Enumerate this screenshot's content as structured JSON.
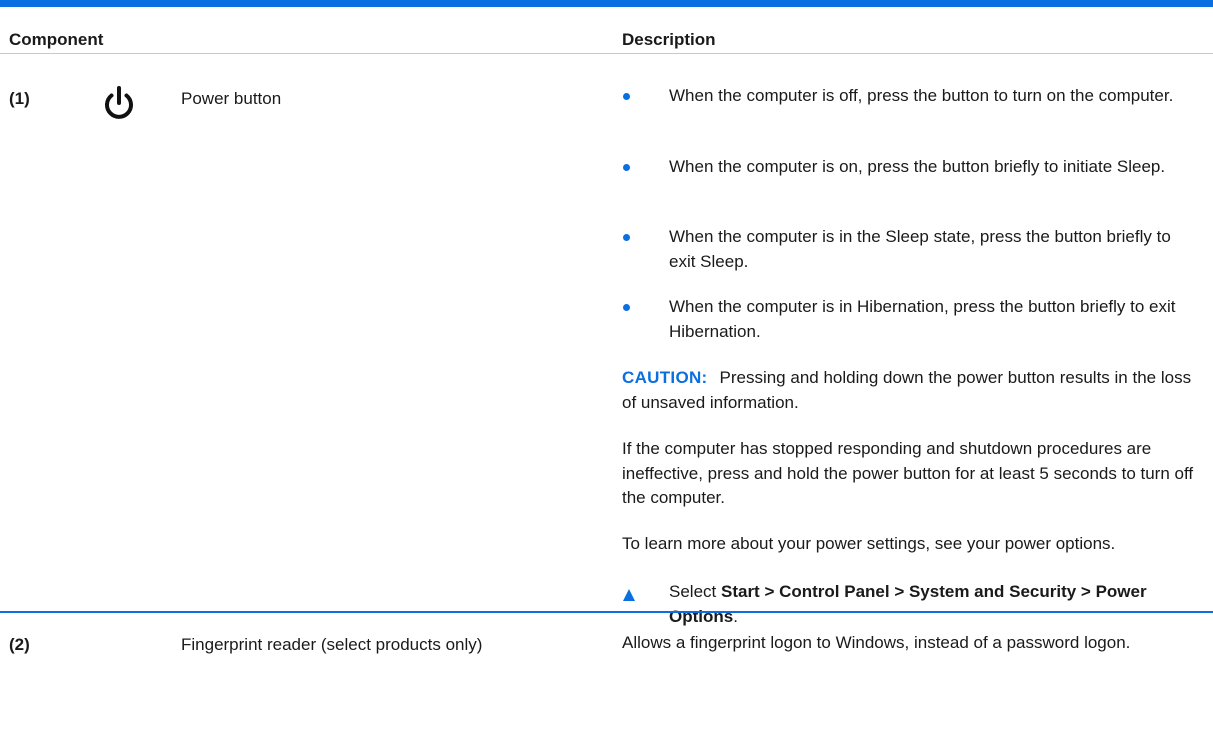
{
  "table": {
    "headers": {
      "component": "Component",
      "description": "Description"
    },
    "rows": [
      {
        "number": "(1)",
        "icon": "power-icon",
        "name": "Power button",
        "bullets": [
          "When the computer is off, press the button to turn on the computer.",
          "When the computer is on, press the button briefly to initiate Sleep.",
          "When the computer is in the Sleep state, press the button briefly to exit Sleep.",
          "When the computer is in Hibernation, press the button briefly to exit Hibernation."
        ],
        "caution_label": "CAUTION:",
        "caution_text": "Pressing and holding down the power button results in the loss of unsaved information.",
        "paragraph_1": "If the computer has stopped responding and shutdown procedures are ineffective, press and hold the power button for at least 5 seconds to turn off the computer.",
        "paragraph_2": "To learn more about your power settings, see your power options.",
        "step": {
          "prefix": "Select ",
          "path": "Start > Control Panel > System and Security > Power Options",
          "suffix": "."
        }
      },
      {
        "number": "(2)",
        "name": "Fingerprint reader (select products only)",
        "description": "Allows a fingerprint logon to Windows, instead of a password logon."
      }
    ]
  },
  "colors": {
    "accent": "#0a6fe0",
    "text": "#1a1a1a",
    "rule": "#c9c9c9"
  }
}
